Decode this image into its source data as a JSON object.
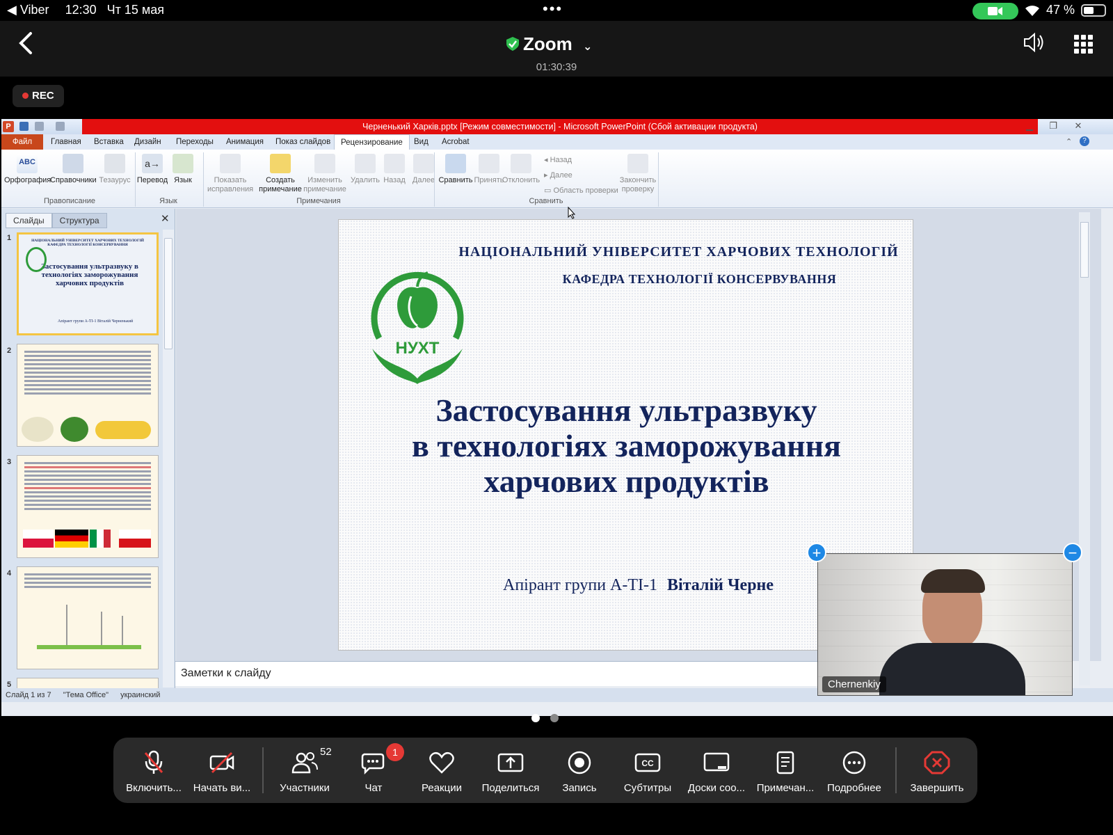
{
  "status_bar": {
    "app_back": "◀ Viber",
    "time": "12:30",
    "date": "Чт 15 мая",
    "battery": "47 %"
  },
  "zoom": {
    "title": "Zoom",
    "timer": "01:30:39",
    "rec_label": "REC"
  },
  "powerpoint": {
    "window_title": "Черненький Харків.pptx [Режим совместимости] - Microsoft PowerPoint (Сбой активации продукта)",
    "tabs": [
      "Файл",
      "Главная",
      "Вставка",
      "Дизайн",
      "Переходы",
      "Анимация",
      "Показ слайдов",
      "Рецензирование",
      "Вид",
      "Acrobat"
    ],
    "active_tab": "Рецензирование",
    "ribbon": {
      "spelling": "Орфография",
      "references": "Справочники",
      "thesaurus": "Тезаурус",
      "translate": "Перевод",
      "language": "Язык",
      "show_corr_1": "Показать",
      "show_corr_2": "исправления",
      "create_note_1": "Создать",
      "create_note_2": "примечание",
      "edit_note_1": "Изменить",
      "edit_note_2": "примечание",
      "delete": "Удалить",
      "back": "Назад",
      "next": "Далее",
      "compare": "Сравнить",
      "accept": "Принять",
      "reject": "Отклонить",
      "prev_small": "Назад",
      "next_small": "Далее",
      "review_pane": "Область проверки",
      "finish_1": "Закончить",
      "finish_2": "проверку",
      "grp_proofing": "Правописание",
      "grp_language": "Язык",
      "grp_comments": "Примечания",
      "grp_compare": "Сравнить"
    },
    "panel_tabs": [
      "Слайды",
      "Структура"
    ],
    "thumb1": {
      "l1": "НАЦІОНАЛЬНИЙ УНІВЕРСИТЕТ ХАРЧОВИХ ТЕХНОЛОГІЙ",
      "l2": "КАФЕДРА ТЕХНОЛОГІЇ КОНСЕРВУВАННЯ",
      "title": "Застосування ультразвуку в технологіях заморожування харчових продуктів",
      "author": "Апірант групи А-ТІ-1 Віталій Черненький"
    },
    "slide_numbers": [
      "1",
      "2",
      "3",
      "4",
      "5"
    ],
    "slide": {
      "university": "НАЦІОНАЛЬНИЙ УНІВЕРСИТЕТ ХАРЧОВИХ ТЕХНОЛОГІЙ",
      "department": "КАФЕДРА ТЕХНОЛОГІЇ КОНСЕРВУВАННЯ",
      "logo_text": "НУХТ",
      "title_1": "Застосування ультразвуку",
      "title_2": "в технологіях заморожування",
      "title_3": "харчових продуктів",
      "author_prefix": "Апірант групи  А-ТІ-1",
      "author_name": "Віталій Черне"
    },
    "notes_placeholder": "Заметки к слайду",
    "status": [
      "Слайд 1 из 7",
      "\"Тема Office\"",
      "украинский"
    ]
  },
  "video": {
    "participant": "Chernenkiy"
  },
  "toolbar": {
    "mic": "Включить...",
    "video": "Начать ви...",
    "participants": "Участники",
    "participants_count": "52",
    "chat": "Чат",
    "chat_badge": "1",
    "reactions": "Реакции",
    "share": "Поделиться",
    "record": "Запись",
    "captions": "Субтитры",
    "whiteboards": "Доски соо...",
    "notes": "Примечан...",
    "more": "Подробнее",
    "end": "Завершить"
  },
  "colors": {
    "title_red": "#e30f0f",
    "slide_navy": "#13245c",
    "logo_green": "#2e9b3a",
    "end_red": "#e53935",
    "zoom_blue": "#1e88e5"
  }
}
